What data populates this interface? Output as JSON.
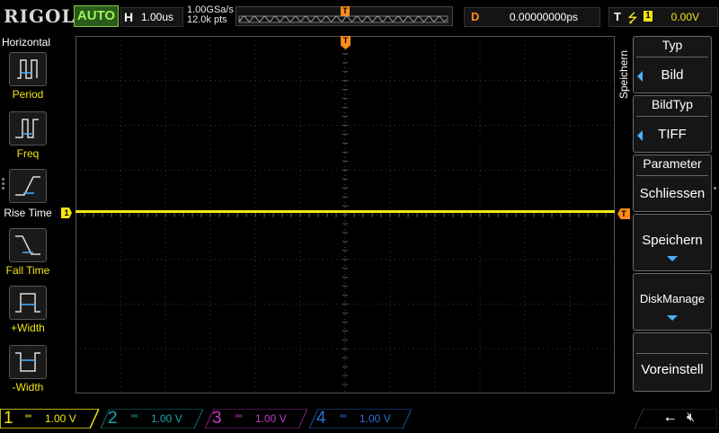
{
  "topbar": {
    "brand": "RIGOL",
    "run_mode": "AUTO",
    "horizontal_key": "H",
    "horizontal_scale": "1.00us",
    "sample_rate": "1.00GSa/s",
    "memory_depth": "12.0k pts",
    "trigger_marker": "T",
    "delay_key": "D",
    "delay_value": "0.00000000ps",
    "trigger_key": "T",
    "trigger_source": "1",
    "trigger_level": "0.00V"
  },
  "left_menu": {
    "title": "Horizontal",
    "items": [
      {
        "label": "Period",
        "icon": "period-measure-icon"
      },
      {
        "label": "Freq",
        "icon": "frequency-measure-icon"
      },
      {
        "label": "Rise Time",
        "icon": "rise-time-icon"
      },
      {
        "label": "Fall Time",
        "icon": "fall-time-icon"
      },
      {
        "label": "+Width",
        "icon": "positive-width-icon"
      },
      {
        "label": "-Width",
        "icon": "negative-width-icon"
      }
    ]
  },
  "waveform": {
    "channel_marker": "1",
    "trigger_top_marker": "T",
    "trigger_level_marker": "T",
    "trace_color": "#f1e516"
  },
  "right_menu": {
    "title": "Speichern",
    "items": [
      {
        "heading": "Typ",
        "value": "Bild"
      },
      {
        "heading": "BildTyp",
        "value": "TIFF"
      },
      {
        "heading": "Parameter",
        "value": "Schliessen"
      },
      {
        "heading": "",
        "value": "Speichern"
      },
      {
        "heading": "",
        "value": "DiskManage"
      },
      {
        "heading": "",
        "value": "Voreinstell"
      }
    ]
  },
  "channels": [
    {
      "number": "1",
      "scale": "1.00 V",
      "color": "#f1e516",
      "active": true
    },
    {
      "number": "2",
      "scale": "1.00 V",
      "color": "#1aa8a8",
      "active": false
    },
    {
      "number": "3",
      "scale": "1.00 V",
      "color": "#c33cc3",
      "active": false
    },
    {
      "number": "4",
      "scale": "1.00 V",
      "color": "#2a70d8",
      "active": false
    }
  ],
  "status_icons": [
    "usb-icon",
    "speaker-muted-icon"
  ],
  "colors": {
    "channel1": "#f1e516",
    "accent_blue": "#4ab0ff",
    "trigger_orange": "#ff8c1a",
    "auto_green": "#7ccf42"
  }
}
